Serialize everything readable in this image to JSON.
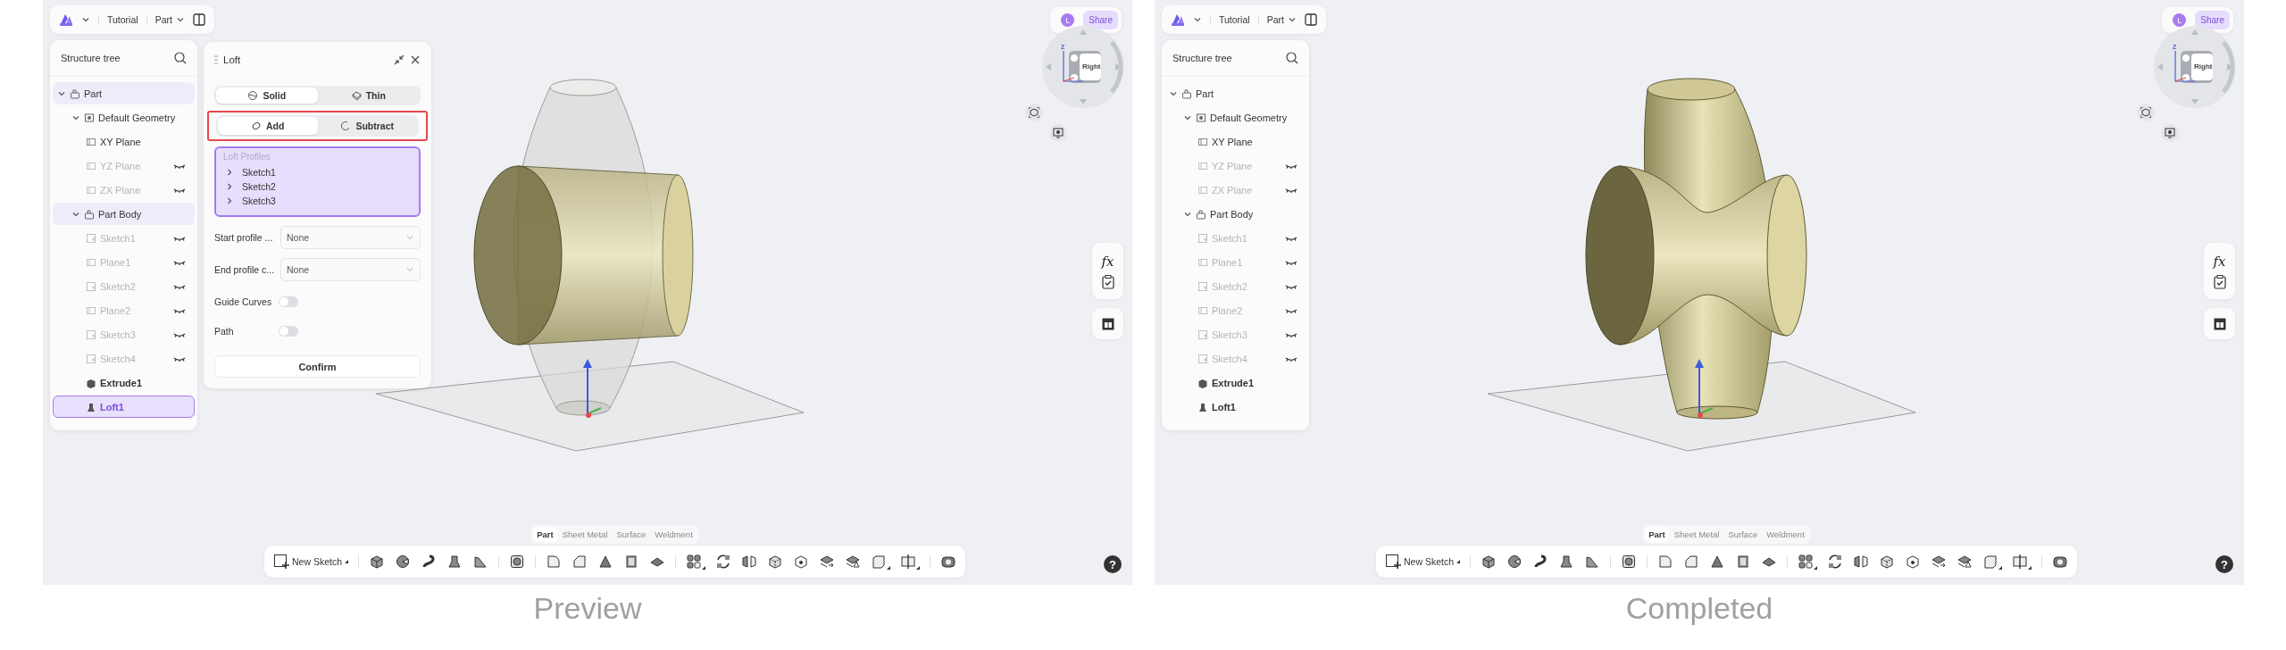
{
  "screens": [
    {
      "caption": "Preview",
      "model": {
        "kind": "preview"
      },
      "topbar": {
        "project": "Tutorial",
        "document": "Part"
      },
      "account": {
        "avatar": "L",
        "share": "Share"
      },
      "view_cube": {
        "face": "Right",
        "axis": "Z"
      },
      "tree": {
        "title": "Structure tree",
        "items": [
          {
            "label": "Part",
            "kind": "part",
            "expanded": true,
            "highlighted": true,
            "selected": false,
            "hidden": false,
            "children": [
              {
                "label": "Default Geometry",
                "kind": "geometry",
                "expanded": true,
                "highlighted": false,
                "selected": false,
                "hidden": false,
                "children": [
                  {
                    "label": "XY Plane",
                    "kind": "plane",
                    "highlighted": false,
                    "selected": false,
                    "hidden": false
                  },
                  {
                    "label": "YZ Plane",
                    "kind": "plane",
                    "highlighted": false,
                    "selected": false,
                    "hidden": true
                  },
                  {
                    "label": "ZX Plane",
                    "kind": "plane",
                    "highlighted": false,
                    "selected": false,
                    "hidden": true
                  }
                ]
              },
              {
                "label": "Part Body",
                "kind": "body",
                "expanded": true,
                "highlighted": true,
                "selected": false,
                "hidden": false,
                "children": [
                  {
                    "label": "Sketch1",
                    "kind": "sketch",
                    "highlighted": false,
                    "selected": false,
                    "hidden": true
                  },
                  {
                    "label": "Plane1",
                    "kind": "plane",
                    "highlighted": false,
                    "selected": false,
                    "hidden": true
                  },
                  {
                    "label": "Sketch2",
                    "kind": "sketch",
                    "highlighted": false,
                    "selected": false,
                    "hidden": true
                  },
                  {
                    "label": "Plane2",
                    "kind": "plane",
                    "highlighted": false,
                    "selected": false,
                    "hidden": true
                  },
                  {
                    "label": "Sketch3",
                    "kind": "sketch",
                    "highlighted": false,
                    "selected": false,
                    "hidden": true
                  },
                  {
                    "label": "Sketch4",
                    "kind": "sketch",
                    "highlighted": false,
                    "selected": false,
                    "hidden": true
                  },
                  {
                    "label": "Extrude1",
                    "kind": "extrude",
                    "highlighted": false,
                    "selected": false,
                    "hidden": false
                  },
                  {
                    "label": "Loft1",
                    "kind": "loft",
                    "highlighted": false,
                    "selected": true,
                    "hidden": false
                  }
                ]
              }
            ]
          }
        ]
      },
      "loft_panel": {
        "title": "Loft",
        "body_types": [
          {
            "label": "Solid",
            "kind": "solid",
            "selected": true
          },
          {
            "label": "Thin",
            "kind": "thin",
            "selected": false
          }
        ],
        "operations": {
          "outlined": true,
          "items": [
            {
              "label": "Add",
              "kind": "add",
              "selected": true
            },
            {
              "label": "Subtract",
              "kind": "subtract",
              "selected": false
            }
          ]
        },
        "profiles": {
          "label": "Loft Profiles",
          "active": true,
          "items": [
            "Sketch1",
            "Sketch2",
            "Sketch3"
          ]
        },
        "fields": [
          {
            "label": "Start profile ...",
            "value": "None"
          },
          {
            "label": "End profile c...",
            "value": "None"
          }
        ],
        "toggles": [
          {
            "label": "Guide Curves",
            "on": false
          },
          {
            "label": "Path",
            "on": false
          }
        ],
        "confirm": "Confirm"
      },
      "side_tools": {
        "formula": "fx"
      },
      "mode_tabs": [
        {
          "label": "Part",
          "selected": true
        },
        {
          "label": "Sheet Metal",
          "selected": false
        },
        {
          "label": "Surface",
          "selected": false
        },
        {
          "label": "Weldment",
          "selected": false
        }
      ],
      "toolbar": {
        "new_sketch": "New Sketch"
      },
      "help": "?"
    },
    {
      "caption": "Completed",
      "model": {
        "kind": "completed"
      },
      "topbar": {
        "project": "Tutorial",
        "document": "Part"
      },
      "account": {
        "avatar": "L",
        "share": "Share"
      },
      "view_cube": {
        "face": "Right",
        "axis": "Z"
      },
      "tree": {
        "title": "Structure tree",
        "items": [
          {
            "label": "Part",
            "kind": "part",
            "expanded": true,
            "highlighted": false,
            "selected": false,
            "hidden": false,
            "children": [
              {
                "label": "Default Geometry",
                "kind": "geometry",
                "expanded": true,
                "highlighted": false,
                "selected": false,
                "hidden": false,
                "children": [
                  {
                    "label": "XY Plane",
                    "kind": "plane",
                    "highlighted": false,
                    "selected": false,
                    "hidden": false
                  },
                  {
                    "label": "YZ Plane",
                    "kind": "plane",
                    "highlighted": false,
                    "selected": false,
                    "hidden": true
                  },
                  {
                    "label": "ZX Plane",
                    "kind": "plane",
                    "highlighted": false,
                    "selected": false,
                    "hidden": true
                  }
                ]
              },
              {
                "label": "Part Body",
                "kind": "body",
                "expanded": true,
                "highlighted": false,
                "selected": false,
                "hidden": false,
                "children": [
                  {
                    "label": "Sketch1",
                    "kind": "sketch",
                    "highlighted": false,
                    "selected": false,
                    "hidden": true
                  },
                  {
                    "label": "Plane1",
                    "kind": "plane",
                    "highlighted": false,
                    "selected": false,
                    "hidden": true
                  },
                  {
                    "label": "Sketch2",
                    "kind": "sketch",
                    "highlighted": false,
                    "selected": false,
                    "hidden": true
                  },
                  {
                    "label": "Plane2",
                    "kind": "plane",
                    "highlighted": false,
                    "selected": false,
                    "hidden": true
                  },
                  {
                    "label": "Sketch3",
                    "kind": "sketch",
                    "highlighted": false,
                    "selected": false,
                    "hidden": true
                  },
                  {
                    "label": "Sketch4",
                    "kind": "sketch",
                    "highlighted": false,
                    "selected": false,
                    "hidden": true
                  },
                  {
                    "label": "Extrude1",
                    "kind": "extrude",
                    "highlighted": false,
                    "selected": false,
                    "hidden": false
                  },
                  {
                    "label": "Loft1",
                    "kind": "loft",
                    "highlighted": false,
                    "selected": false,
                    "hidden": false
                  }
                ]
              }
            ]
          }
        ]
      },
      "side_tools": {
        "formula": "fx"
      },
      "mode_tabs": [
        {
          "label": "Part",
          "selected": true
        },
        {
          "label": "Sheet Metal",
          "selected": false
        },
        {
          "label": "Surface",
          "selected": false
        },
        {
          "label": "Weldment",
          "selected": false
        }
      ],
      "toolbar": {
        "new_sketch": "New Sketch"
      },
      "help": "?"
    }
  ]
}
